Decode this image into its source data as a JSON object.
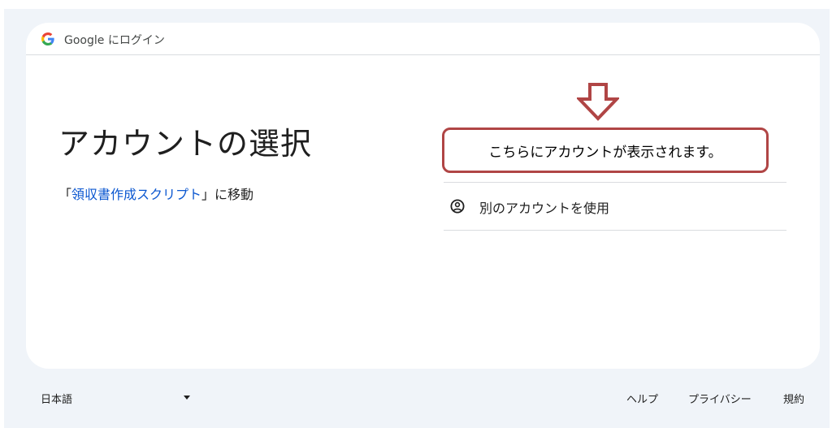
{
  "header": {
    "title": "Google にログイン",
    "logo_icon": "google-g-icon"
  },
  "main": {
    "heading": "アカウントの選択",
    "subtitle_prefix": "「",
    "app_name": "領収書作成スクリプト",
    "subtitle_suffix": "」に移動"
  },
  "annotation": {
    "callout_text": "こちらにアカウントが表示されます。",
    "arrow_icon": "down-arrow-icon",
    "accent_color": "#b04545"
  },
  "accounts": {
    "use_another_label": "別のアカウントを使用",
    "use_another_icon": "account-circle-icon"
  },
  "footer": {
    "language": "日本語",
    "language_icon": "caret-down-icon",
    "help_label": "ヘルプ",
    "privacy_label": "プライバシー",
    "terms_label": "規約"
  },
  "colors": {
    "background": "#f0f4f9",
    "link": "#0b57d0",
    "text": "#1f1f1f"
  }
}
